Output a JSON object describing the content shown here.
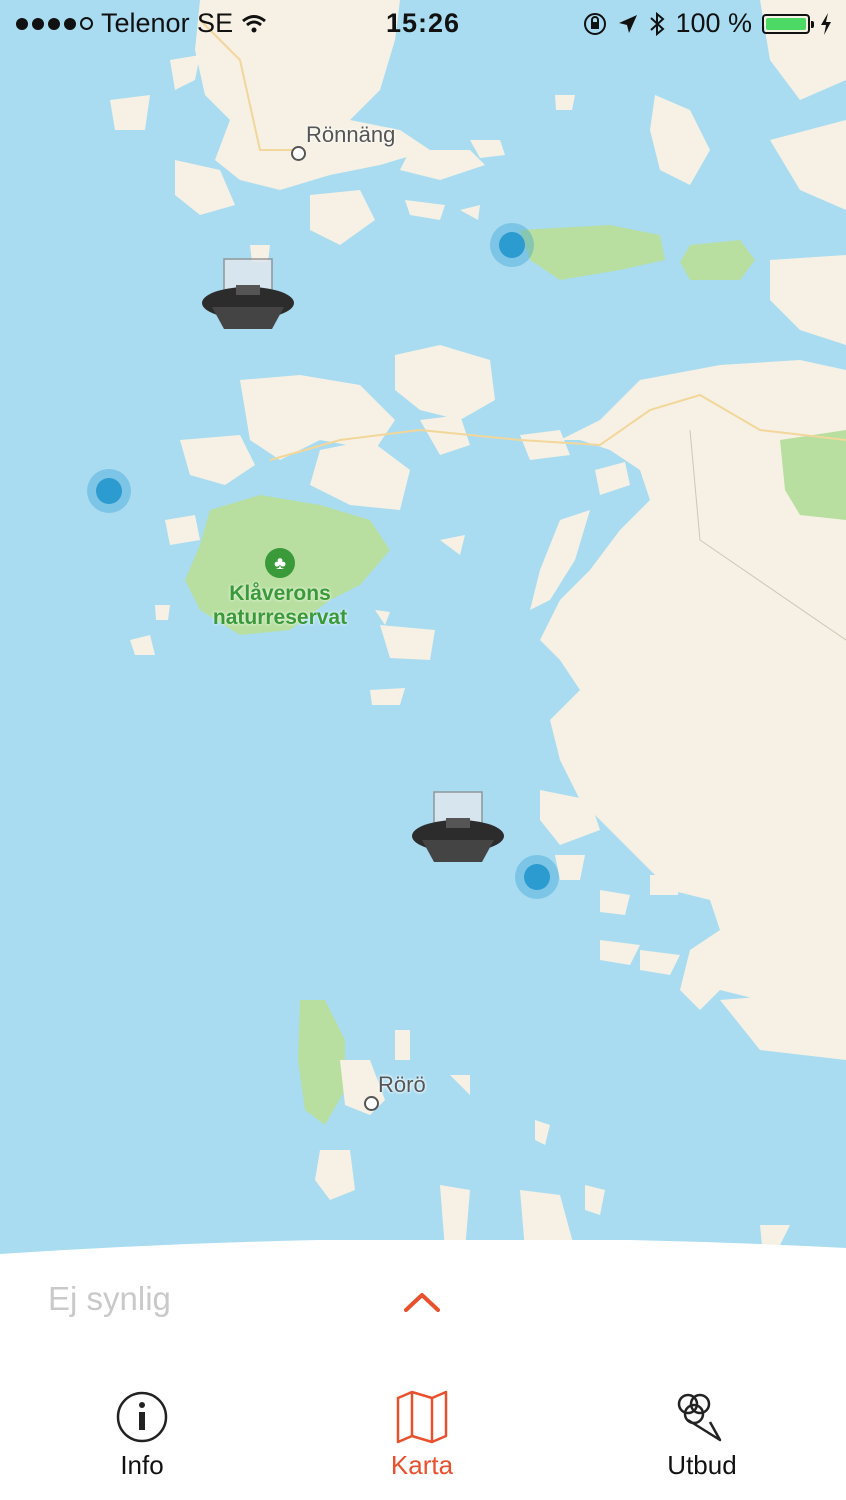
{
  "status_bar": {
    "carrier": "Telenor SE",
    "time": "15:26",
    "battery": "100 %"
  },
  "map": {
    "places": [
      {
        "name": "Rönnäng"
      },
      {
        "name": "Rörö"
      }
    ],
    "park": {
      "line1": "Klåverons",
      "line2": "naturreservat"
    },
    "colors": {
      "water": "#a9dcf1",
      "land": "#f6f1e4",
      "park": "#b8dfa0",
      "marker": "#2c9bd0"
    }
  },
  "sheet": {
    "status_text": "Ej synlig",
    "tabs": [
      {
        "label": "Info",
        "icon": "info-icon",
        "active": false
      },
      {
        "label": "Karta",
        "icon": "map-icon",
        "active": true
      },
      {
        "label": "Utbud",
        "icon": "services-icon",
        "active": false
      }
    ],
    "accent": "#e9502d"
  }
}
